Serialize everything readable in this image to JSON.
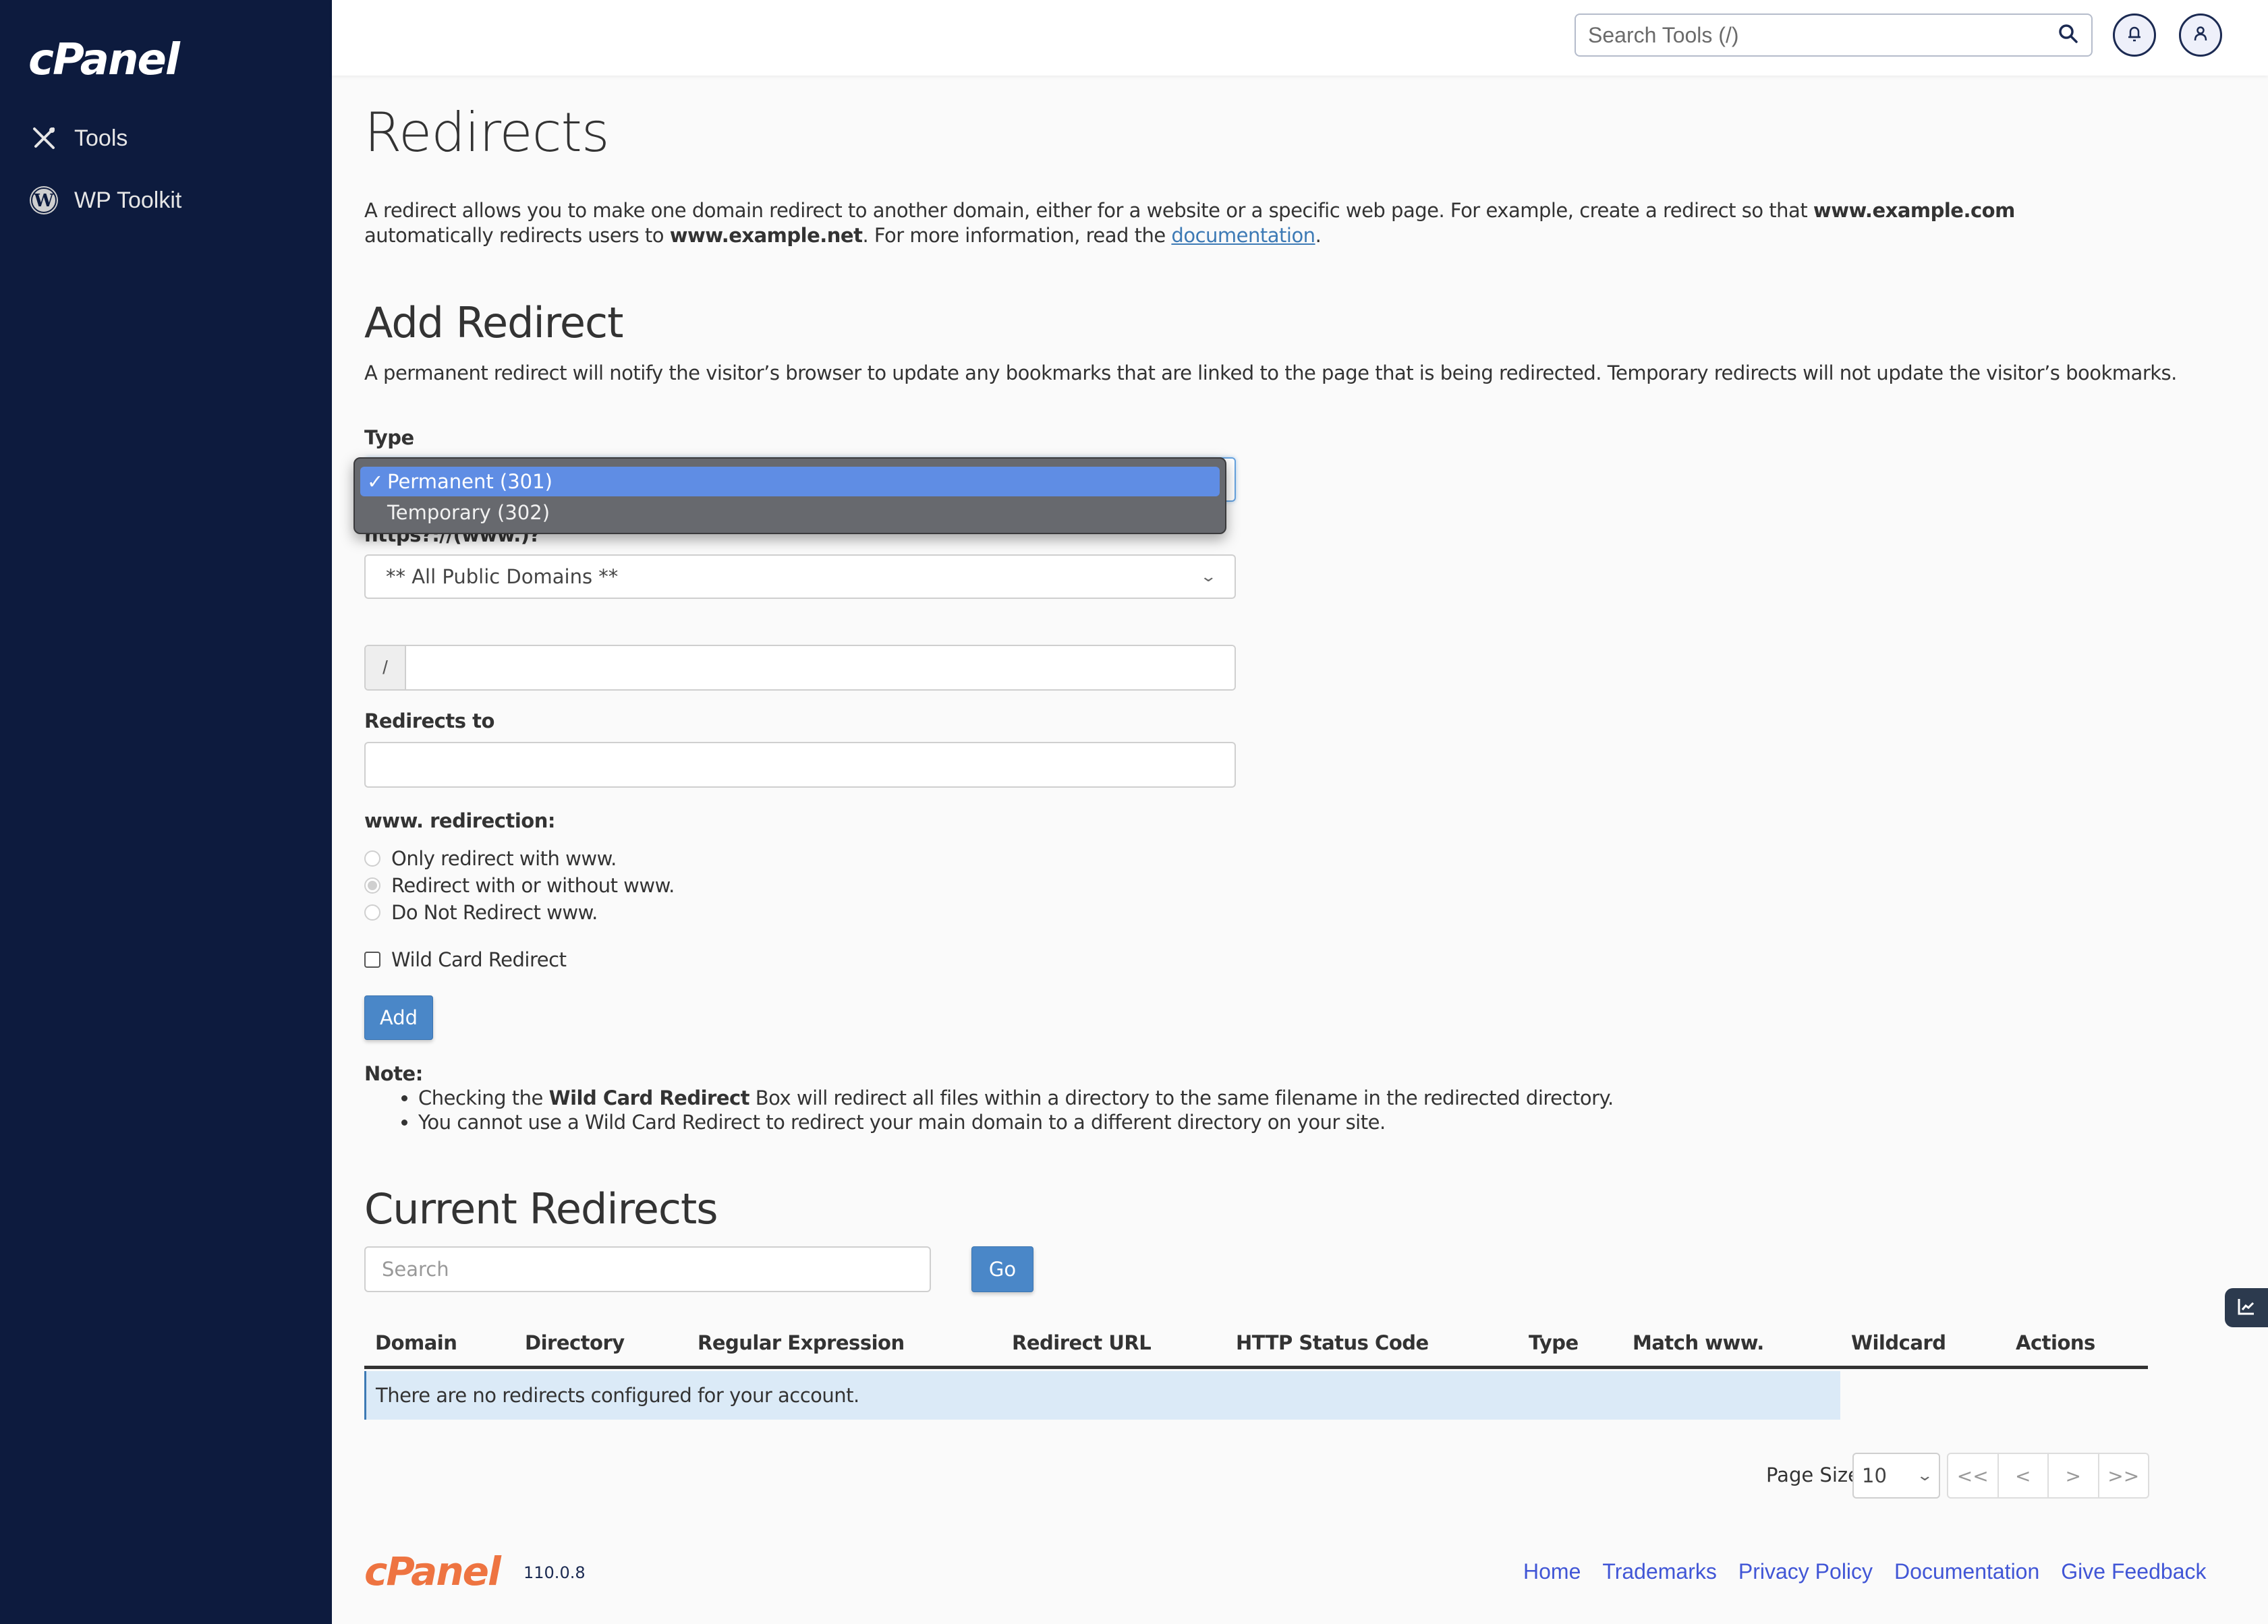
{
  "app": {
    "logo": "cPanel",
    "version": "110.0.8"
  },
  "sidebar": {
    "items": [
      {
        "label": "Tools",
        "icon": "tools-icon"
      },
      {
        "label": "WP Toolkit",
        "icon": "wordpress-icon"
      }
    ]
  },
  "header": {
    "search_placeholder": "Search Tools (/)",
    "search_icon": "search-icon",
    "notifications_icon": "bell-icon",
    "user_icon": "user-icon"
  },
  "page": {
    "title": "Redirects",
    "intro_part1": "A redirect allows you to make one domain redirect to another domain, either for a website or a specific web page. For example, create a redirect so that ",
    "intro_bold1": "www.example.com",
    "intro_part2": " automatically redirects users to ",
    "intro_bold2": "www.example.net",
    "intro_part3": ". For more information, read the ",
    "intro_link": "documentation",
    "intro_part4": "."
  },
  "add_redirect": {
    "title": "Add Redirect",
    "description": "A permanent redirect will notify the visitor’s browser to update any bookmarks that are linked to the page that is being redirected. Temporary redirects will not update the visitor’s bookmarks.",
    "type_label": "Type",
    "type_options": [
      {
        "label": "Permanent (301)",
        "selected": true
      },
      {
        "label": "Temporary (302)",
        "selected": false
      }
    ],
    "check_mark": "✓",
    "domain_label": "https?://(www.)?",
    "domain_value": "** All Public Domains **",
    "path_prefix": "/",
    "path_value": "",
    "redirects_to_label": "Redirects to",
    "redirects_to_value": "",
    "www_label": "www. redirection:",
    "www_options": [
      {
        "label": "Only redirect with www.",
        "checked": false
      },
      {
        "label": "Redirect with or without www.",
        "checked": true
      },
      {
        "label": "Do Not Redirect www.",
        "checked": false
      }
    ],
    "wildcard_label": "Wild Card Redirect",
    "wildcard_checked": false,
    "add_button": "Add",
    "note_title": "Note:",
    "note_1_pre": "Checking the ",
    "note_1_bold": "Wild Card Redirect",
    "note_1_post": " Box will redirect all files within a directory to the same filename in the redirected directory.",
    "note_2": "You cannot use a Wild Card Redirect to redirect your main domain to a different directory on your site."
  },
  "current_redirects": {
    "title": "Current Redirects",
    "search_placeholder": "Search",
    "go_button": "Go",
    "columns": [
      "Domain",
      "Directory",
      "Regular Expression",
      "Redirect URL",
      "HTTP Status Code",
      "Type",
      "Match www.",
      "Wildcard",
      "Actions"
    ],
    "empty_message": "There are no redirects configured for your account.",
    "page_size_label": "Page Size",
    "page_size_value": "10",
    "pager": [
      "<<",
      "<",
      ">",
      ">>"
    ]
  },
  "footer": {
    "links": [
      "Home",
      "Trademarks",
      "Privacy Policy",
      "Documentation",
      "Give Feedback"
    ]
  },
  "colors": {
    "sidebar_bg": "#0d1b3e",
    "primary_button": "#4a87c8",
    "link": "#3d7ab5",
    "footer_link": "#4156d6",
    "brand_orange": "#ee7441"
  }
}
